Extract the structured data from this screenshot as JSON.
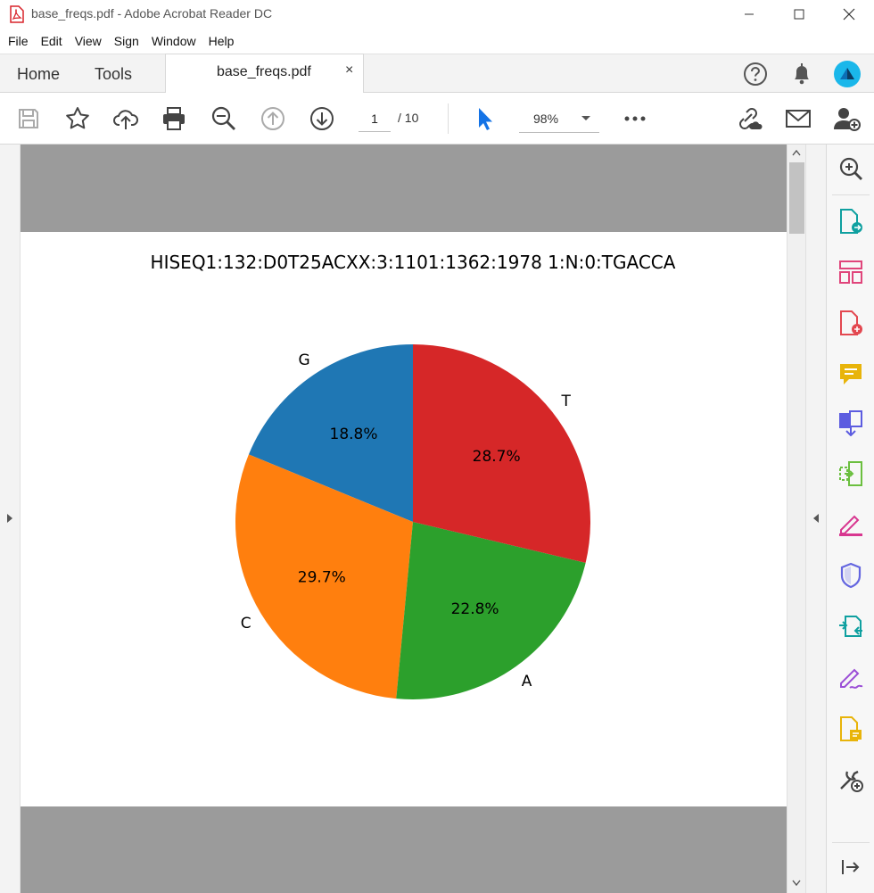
{
  "window": {
    "title": "base_freqs.pdf - Adobe Acrobat Reader DC",
    "controls": {
      "minimize": "—",
      "maximize": "☐",
      "close": "✕"
    }
  },
  "menu": [
    "File",
    "Edit",
    "View",
    "Sign",
    "Window",
    "Help"
  ],
  "tabs": {
    "home": "Home",
    "tools": "Tools",
    "document": "base_freqs.pdf",
    "close": "×"
  },
  "toolbar": {
    "page_current": "1",
    "page_total": "/  10",
    "zoom": "98%",
    "icons": [
      "save-icon",
      "bookmark-star-icon",
      "upload-cloud-icon",
      "print-icon",
      "zoom-out-icon",
      "page-up-icon",
      "page-down-icon",
      "select-cursor-icon",
      "zoom-dropdown-icon",
      "more-icon",
      "share-link-icon",
      "email-icon",
      "add-user-icon"
    ]
  },
  "colors": {
    "G": "#1f77b4",
    "C": "#ff7f0e",
    "A": "#2ca02c",
    "T": "#d62728",
    "accent_blue": "#1473e6"
  },
  "chart_data": {
    "type": "pie",
    "title": "HISEQ1:132:D0T25ACXX:3:1101:1362:1978 1:N:0:TGACCA",
    "slices": [
      {
        "label": "G",
        "value": 18.8,
        "pct_label": "18.8%"
      },
      {
        "label": "C",
        "value": 29.7,
        "pct_label": "29.7%"
      },
      {
        "label": "A",
        "value": 22.8,
        "pct_label": "22.8%"
      },
      {
        "label": "T",
        "value": 28.7,
        "pct_label": "28.7%"
      }
    ],
    "start_angle_deg": 90,
    "direction": "counterclockwise",
    "legend": "none"
  },
  "right_pane_icons": [
    "search-zoom-icon",
    "export-pdf-icon",
    "organize-pages-icon",
    "create-pdf-icon",
    "comment-icon",
    "combine-files-icon",
    "compress-pdf-icon",
    "fill-sign-icon",
    "protect-shield-icon",
    "send-review-icon",
    "request-signature-icon",
    "scan-ocr-icon",
    "more-tools-icon",
    "collapse-pane-icon"
  ]
}
